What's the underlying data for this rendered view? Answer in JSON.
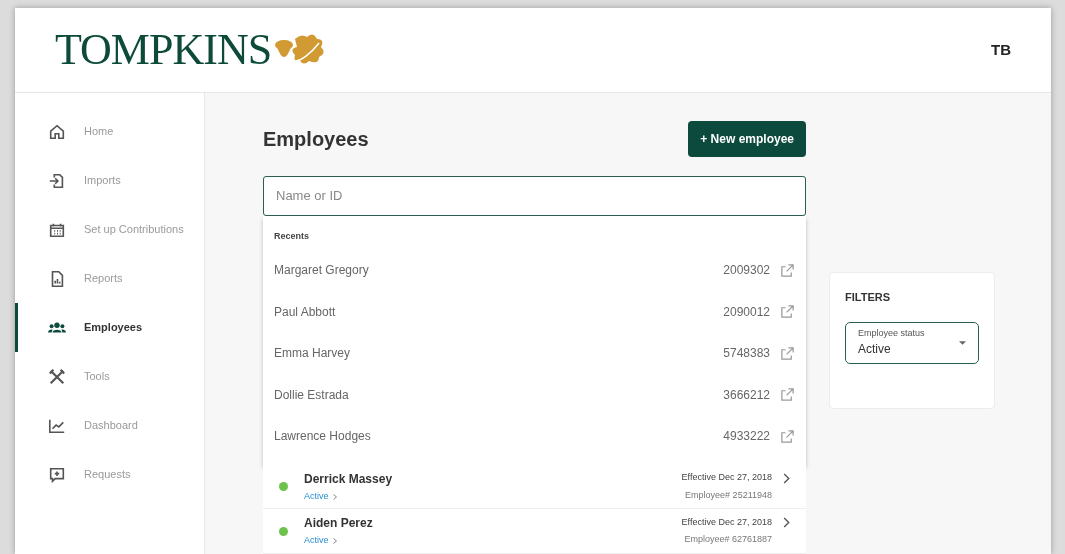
{
  "header": {
    "logo_text": "TOMPKINS",
    "user_initials": "TB"
  },
  "sidebar": {
    "items": [
      {
        "label": "Home",
        "kind": "home",
        "selected": false
      },
      {
        "label": "Imports",
        "kind": "import",
        "selected": false
      },
      {
        "label": "Set up Contributions",
        "kind": "calendar",
        "selected": false
      },
      {
        "label": "Reports",
        "kind": "report",
        "selected": false
      },
      {
        "label": "Employees",
        "kind": "people",
        "selected": true
      },
      {
        "label": "Tools",
        "kind": "tools",
        "selected": false
      },
      {
        "label": "Dashboard",
        "kind": "chart",
        "selected": false
      },
      {
        "label": "Requests",
        "kind": "request",
        "selected": false
      }
    ]
  },
  "main": {
    "title": "Employees",
    "new_button": "+ New employee",
    "search": {
      "placeholder": "Name or ID"
    },
    "recents": {
      "heading": "Recents",
      "items": [
        {
          "name": "Margaret Gregory",
          "id": "2009302"
        },
        {
          "name": "Paul Abbott",
          "id": "2090012"
        },
        {
          "name": "Emma Harvey",
          "id": "5748383"
        },
        {
          "name": "Dollie Estrada",
          "id": "3666212"
        },
        {
          "name": "Lawrence Hodges",
          "id": "4933222"
        }
      ]
    },
    "employees": [
      {
        "name": "Derrick Massey",
        "status": "Active",
        "color": "#6cc24a",
        "effective": "Effective Dec 27, 2018",
        "number": "Employee# 25211948"
      },
      {
        "name": "Aiden Perez",
        "status": "Active",
        "color": "#6cc24a",
        "effective": "Effective Dec 27, 2018",
        "number": "Employee# 62761887"
      }
    ]
  },
  "filters": {
    "title": "FILTERS",
    "status_select": {
      "label": "Employee status",
      "value": "Active"
    }
  }
}
